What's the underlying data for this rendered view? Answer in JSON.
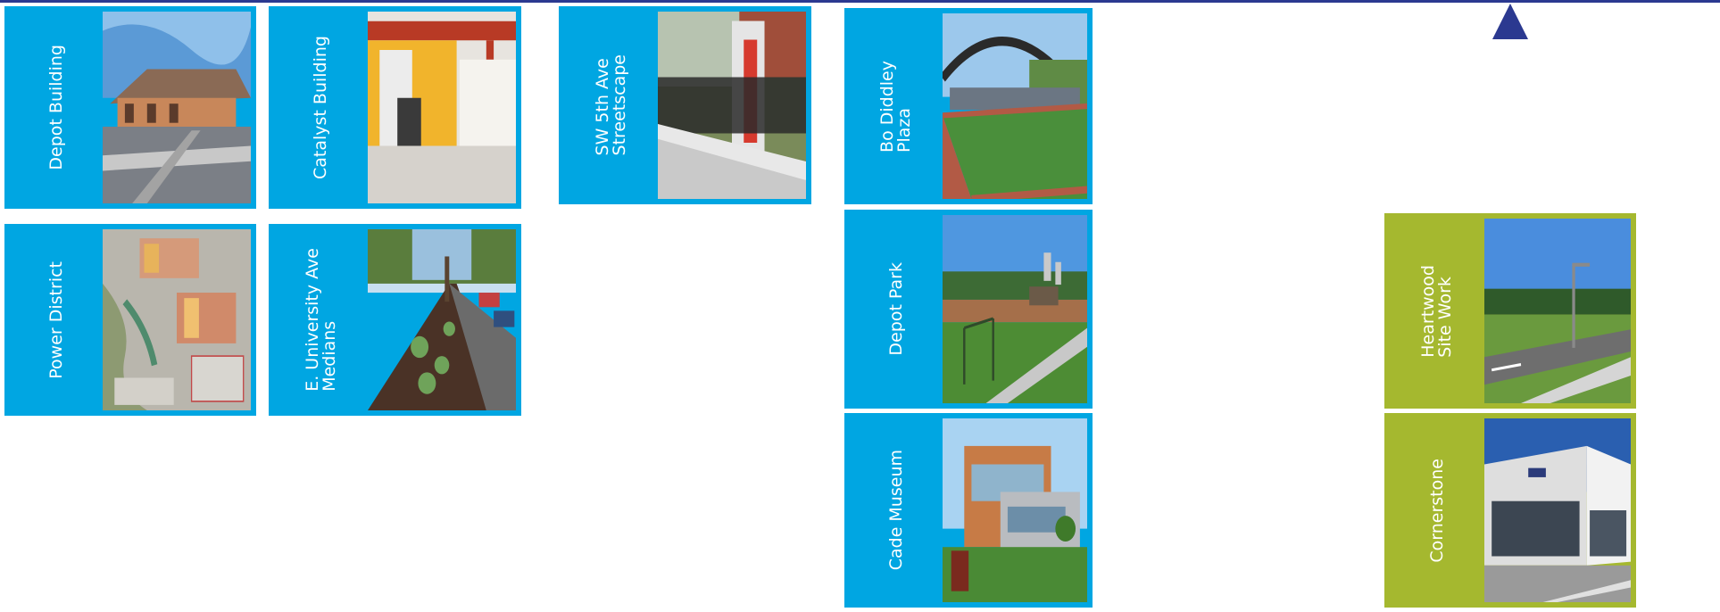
{
  "colors": {
    "blue": "#00a6e2",
    "green": "#a5b82f",
    "navy": "#2b3990"
  },
  "markers": {
    "triangle_icon": "up-triangle-icon"
  },
  "cards": {
    "depot_building": {
      "label": "Depot Building",
      "photo_icon": "train-depot-photo"
    },
    "catalyst_building": {
      "label": "Catalyst Building",
      "photo_icon": "building-entrance-photo"
    },
    "power_district": {
      "label": "Power District",
      "photo_icon": "site-plan-map-photo"
    },
    "e_university_ave": {
      "label": "E. University Ave\nMedians",
      "photo_icon": "street-median-photo"
    },
    "sw_5th_ave": {
      "label": "SW 5th Ave\nStreetscape",
      "photo_icon": "streetscape-sign-photo"
    },
    "bo_diddley": {
      "label": "Bo Diddley\nPlaza",
      "photo_icon": "plaza-canopy-photo"
    },
    "depot_park": {
      "label": "Depot Park",
      "photo_icon": "park-playground-photo"
    },
    "cade_museum": {
      "label": "Cade Museum",
      "photo_icon": "museum-building-photo"
    },
    "heartwood": {
      "label": "Heartwood\nSite Work",
      "photo_icon": "road-site-work-photo"
    },
    "cornerstone": {
      "label": "Cornerstone",
      "photo_icon": "office-building-photo"
    }
  }
}
